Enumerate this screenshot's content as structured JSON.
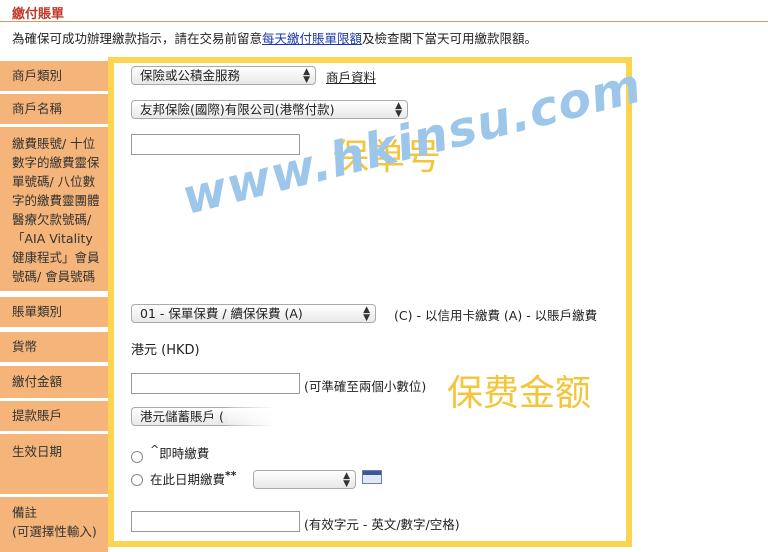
{
  "page": {
    "title": "繳付賬單",
    "intro_before": "為確保可成功辦理繳款指示，請在交易前留意",
    "intro_link": "每天繳付賬單限額",
    "intro_after": "及檢查閣下當天可用繳款限額。"
  },
  "labels": {
    "merchant_category": "商戶類別",
    "merchant_name": "商戶名稱",
    "account_no": [
      "繳費賬號/ 十位",
      "數字的繳費靈保",
      "單號碼/ 八位數",
      "字的繳費靈團體",
      "醫療欠款號碼/",
      "「AIA Vitality",
      "健康程式」會員",
      "號碼/ 會員號碼"
    ],
    "bill_type": "賬單類別",
    "currency": "貨幣",
    "amount": "繳付金額",
    "debit_account": "提款賬戶",
    "effective_date": "生效日期",
    "remarks": [
      "備註",
      "(可選擇性輸入)"
    ]
  },
  "fields": {
    "merchant_category_value": "保險或公積金服務",
    "merchant_info_link": "商戶資料",
    "merchant_name_value": "友邦保險(國際)有限公司(港幣付款)",
    "account_no_value": "",
    "bill_type_value": "01 - 保單保費 / 續保保費 (A)",
    "bill_type_note": "(C) - 以信用卡繳費   (A) - 以賬戶繳費",
    "currency_value": "港元 (HKD)",
    "amount_value": "",
    "amount_hint": "(可準確至兩個小數位)",
    "debit_account_value": "港元儲蓄賬戶 (",
    "immediate_prefix": "^",
    "immediate_label": "即時繳費",
    "scheduled_label": "在此日期繳費",
    "scheduled_suffix": "**",
    "scheduled_date_value": "",
    "remarks_value": "",
    "remarks_hint": "(有效字元 - 英文/數字/空格)"
  },
  "watermark": {
    "policy_no": "保单号",
    "premium_amount": "保费金额",
    "site": "www.hkinsu.com"
  }
}
